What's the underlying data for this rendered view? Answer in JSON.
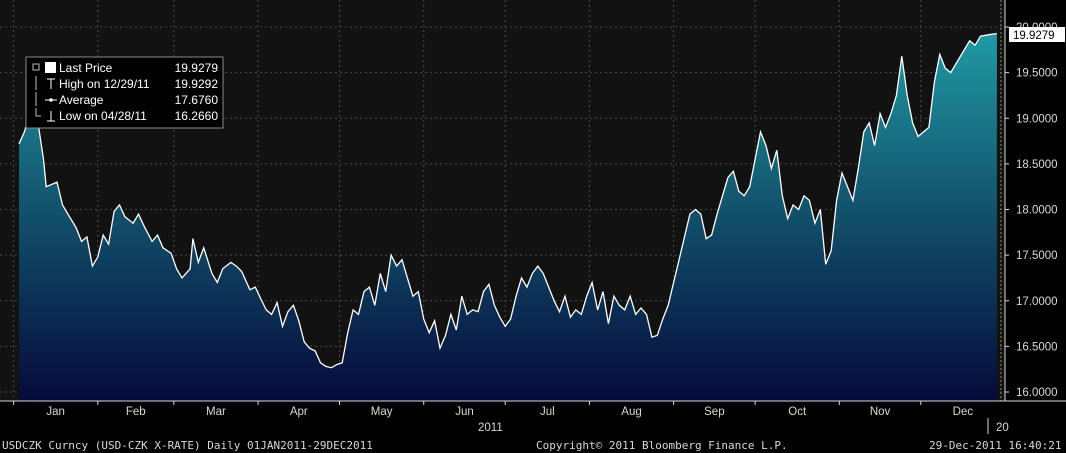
{
  "chart_data": {
    "type": "area",
    "title": "",
    "xlabel": "2011",
    "ylabel": "",
    "ylim": [
      15.95,
      20.05
    ],
    "yticks": [
      "16.0000",
      "16.5000",
      "17.0000",
      "17.5000",
      "18.0000",
      "18.5000",
      "19.0000",
      "19.5000",
      "20.0000"
    ],
    "month_labels": [
      "Jan",
      "Feb",
      "Mar",
      "Apr",
      "May",
      "Jun",
      "Jul",
      "Aug",
      "Sep",
      "Oct",
      "Nov",
      "Dec"
    ],
    "year_label": "2011",
    "next_year_label": "20",
    "last_price_label": "19.9279",
    "grid": true,
    "legend_placement": "top-left",
    "legend": [
      {
        "name": "Last Price",
        "value": "19.9279",
        "icon": "filled-square-icon"
      },
      {
        "name": "High on 12/29/11",
        "value": "19.9292",
        "icon": "high-marker-icon"
      },
      {
        "name": "Average",
        "value": "17.6760",
        "icon": "average-line-icon"
      },
      {
        "name": "Low on 04/28/11",
        "value": "16.2660",
        "icon": "low-marker-icon"
      }
    ],
    "series": [
      {
        "values": [
          {
            "x": "2011-01-03",
            "y": 18.72
          },
          {
            "x": "2011-01-05",
            "y": 18.85
          },
          {
            "x": "2011-01-07",
            "y": 19.05
          },
          {
            "x": "2011-01-10",
            "y": 18.95
          },
          {
            "x": "2011-01-12",
            "y": 18.55
          },
          {
            "x": "2011-01-13",
            "y": 18.25
          },
          {
            "x": "2011-01-17",
            "y": 18.3
          },
          {
            "x": "2011-01-19",
            "y": 18.05
          },
          {
            "x": "2011-01-21",
            "y": 17.95
          },
          {
            "x": "2011-01-24",
            "y": 17.8
          },
          {
            "x": "2011-01-26",
            "y": 17.65
          },
          {
            "x": "2011-01-28",
            "y": 17.7
          },
          {
            "x": "2011-01-30",
            "y": 17.38
          },
          {
            "x": "2011-02-01",
            "y": 17.48
          },
          {
            "x": "2011-02-03",
            "y": 17.72
          },
          {
            "x": "2011-02-05",
            "y": 17.62
          },
          {
            "x": "2011-02-07",
            "y": 17.98
          },
          {
            "x": "2011-02-09",
            "y": 18.05
          },
          {
            "x": "2011-02-11",
            "y": 17.92
          },
          {
            "x": "2011-02-14",
            "y": 17.85
          },
          {
            "x": "2011-02-16",
            "y": 17.95
          },
          {
            "x": "2011-02-18",
            "y": 17.82
          },
          {
            "x": "2011-02-21",
            "y": 17.65
          },
          {
            "x": "2011-02-23",
            "y": 17.72
          },
          {
            "x": "2011-02-25",
            "y": 17.58
          },
          {
            "x": "2011-02-28",
            "y": 17.52
          },
          {
            "x": "2011-03-02",
            "y": 17.35
          },
          {
            "x": "2011-03-04",
            "y": 17.25
          },
          {
            "x": "2011-03-07",
            "y": 17.35
          },
          {
            "x": "2011-03-08",
            "y": 17.68
          },
          {
            "x": "2011-03-10",
            "y": 17.42
          },
          {
            "x": "2011-03-12",
            "y": 17.58
          },
          {
            "x": "2011-03-15",
            "y": 17.3
          },
          {
            "x": "2011-03-17",
            "y": 17.2
          },
          {
            "x": "2011-03-19",
            "y": 17.35
          },
          {
            "x": "2011-03-22",
            "y": 17.42
          },
          {
            "x": "2011-03-24",
            "y": 17.38
          },
          {
            "x": "2011-03-26",
            "y": 17.32
          },
          {
            "x": "2011-03-29",
            "y": 17.12
          },
          {
            "x": "2011-03-31",
            "y": 17.15
          },
          {
            "x": "2011-04-02",
            "y": 17.02
          },
          {
            "x": "2011-04-04",
            "y": 16.9
          },
          {
            "x": "2011-04-06",
            "y": 16.85
          },
          {
            "x": "2011-04-08",
            "y": 16.98
          },
          {
            "x": "2011-04-10",
            "y": 16.72
          },
          {
            "x": "2011-04-12",
            "y": 16.88
          },
          {
            "x": "2011-04-14",
            "y": 16.95
          },
          {
            "x": "2011-04-16",
            "y": 16.78
          },
          {
            "x": "2011-04-18",
            "y": 16.55
          },
          {
            "x": "2011-04-20",
            "y": 16.48
          },
          {
            "x": "2011-04-22",
            "y": 16.45
          },
          {
            "x": "2011-04-24",
            "y": 16.32
          },
          {
            "x": "2011-04-26",
            "y": 16.28
          },
          {
            "x": "2011-04-28",
            "y": 16.266
          },
          {
            "x": "2011-04-30",
            "y": 16.3
          },
          {
            "x": "2011-05-02",
            "y": 16.32
          },
          {
            "x": "2011-05-04",
            "y": 16.65
          },
          {
            "x": "2011-05-06",
            "y": 16.9
          },
          {
            "x": "2011-05-08",
            "y": 16.85
          },
          {
            "x": "2011-05-10",
            "y": 17.1
          },
          {
            "x": "2011-05-12",
            "y": 17.15
          },
          {
            "x": "2011-05-14",
            "y": 16.95
          },
          {
            "x": "2011-05-16",
            "y": 17.3
          },
          {
            "x": "2011-05-18",
            "y": 17.1
          },
          {
            "x": "2011-05-20",
            "y": 17.5
          },
          {
            "x": "2011-05-22",
            "y": 17.38
          },
          {
            "x": "2011-05-24",
            "y": 17.45
          },
          {
            "x": "2011-05-26",
            "y": 17.25
          },
          {
            "x": "2011-05-28",
            "y": 17.05
          },
          {
            "x": "2011-05-30",
            "y": 17.1
          },
          {
            "x": "2011-06-01",
            "y": 16.8
          },
          {
            "x": "2011-06-03",
            "y": 16.65
          },
          {
            "x": "2011-06-05",
            "y": 16.78
          },
          {
            "x": "2011-06-07",
            "y": 16.48
          },
          {
            "x": "2011-06-09",
            "y": 16.62
          },
          {
            "x": "2011-06-11",
            "y": 16.85
          },
          {
            "x": "2011-06-13",
            "y": 16.68
          },
          {
            "x": "2011-06-15",
            "y": 17.05
          },
          {
            "x": "2011-06-17",
            "y": 16.85
          },
          {
            "x": "2011-06-19",
            "y": 16.9
          },
          {
            "x": "2011-06-21",
            "y": 16.88
          },
          {
            "x": "2011-06-23",
            "y": 17.1
          },
          {
            "x": "2011-06-25",
            "y": 17.18
          },
          {
            "x": "2011-06-27",
            "y": 16.95
          },
          {
            "x": "2011-06-29",
            "y": 16.82
          },
          {
            "x": "2011-07-01",
            "y": 16.72
          },
          {
            "x": "2011-07-03",
            "y": 16.8
          },
          {
            "x": "2011-07-05",
            "y": 17.05
          },
          {
            "x": "2011-07-07",
            "y": 17.25
          },
          {
            "x": "2011-07-09",
            "y": 17.15
          },
          {
            "x": "2011-07-11",
            "y": 17.3
          },
          {
            "x": "2011-07-13",
            "y": 17.38
          },
          {
            "x": "2011-07-15",
            "y": 17.3
          },
          {
            "x": "2011-07-17",
            "y": 17.15
          },
          {
            "x": "2011-07-19",
            "y": 17.0
          },
          {
            "x": "2011-07-21",
            "y": 16.88
          },
          {
            "x": "2011-07-23",
            "y": 17.05
          },
          {
            "x": "2011-07-25",
            "y": 16.82
          },
          {
            "x": "2011-07-27",
            "y": 16.9
          },
          {
            "x": "2011-07-29",
            "y": 16.85
          },
          {
            "x": "2011-07-31",
            "y": 17.05
          },
          {
            "x": "2011-08-02",
            "y": 17.2
          },
          {
            "x": "2011-08-04",
            "y": 16.9
          },
          {
            "x": "2011-08-06",
            "y": 17.1
          },
          {
            "x": "2011-08-08",
            "y": 16.75
          },
          {
            "x": "2011-08-10",
            "y": 17.05
          },
          {
            "x": "2011-08-12",
            "y": 16.95
          },
          {
            "x": "2011-08-14",
            "y": 16.9
          },
          {
            "x": "2011-08-16",
            "y": 17.05
          },
          {
            "x": "2011-08-18",
            "y": 16.85
          },
          {
            "x": "2011-08-20",
            "y": 16.92
          },
          {
            "x": "2011-08-22",
            "y": 16.85
          },
          {
            "x": "2011-08-24",
            "y": 16.6
          },
          {
            "x": "2011-08-26",
            "y": 16.62
          },
          {
            "x": "2011-08-28",
            "y": 16.8
          },
          {
            "x": "2011-08-30",
            "y": 16.95
          },
          {
            "x": "2011-09-01",
            "y": 17.2
          },
          {
            "x": "2011-09-03",
            "y": 17.45
          },
          {
            "x": "2011-09-05",
            "y": 17.7
          },
          {
            "x": "2011-09-07",
            "y": 17.95
          },
          {
            "x": "2011-09-09",
            "y": 18.0
          },
          {
            "x": "2011-09-11",
            "y": 17.95
          },
          {
            "x": "2011-09-13",
            "y": 17.68
          },
          {
            "x": "2011-09-15",
            "y": 17.72
          },
          {
            "x": "2011-09-17",
            "y": 17.95
          },
          {
            "x": "2011-09-19",
            "y": 18.15
          },
          {
            "x": "2011-09-21",
            "y": 18.35
          },
          {
            "x": "2011-09-23",
            "y": 18.42
          },
          {
            "x": "2011-09-25",
            "y": 18.2
          },
          {
            "x": "2011-09-27",
            "y": 18.15
          },
          {
            "x": "2011-09-29",
            "y": 18.25
          },
          {
            "x": "2011-10-01",
            "y": 18.55
          },
          {
            "x": "2011-10-03",
            "y": 18.85
          },
          {
            "x": "2011-10-05",
            "y": 18.7
          },
          {
            "x": "2011-10-07",
            "y": 18.45
          },
          {
            "x": "2011-10-09",
            "y": 18.65
          },
          {
            "x": "2011-10-11",
            "y": 18.15
          },
          {
            "x": "2011-10-13",
            "y": 17.9
          },
          {
            "x": "2011-10-15",
            "y": 18.05
          },
          {
            "x": "2011-10-17",
            "y": 18.0
          },
          {
            "x": "2011-10-19",
            "y": 18.15
          },
          {
            "x": "2011-10-21",
            "y": 18.1
          },
          {
            "x": "2011-10-23",
            "y": 17.85
          },
          {
            "x": "2011-10-25",
            "y": 18.0
          },
          {
            "x": "2011-10-27",
            "y": 17.4
          },
          {
            "x": "2011-10-29",
            "y": 17.55
          },
          {
            "x": "2011-10-31",
            "y": 18.1
          },
          {
            "x": "2011-11-02",
            "y": 18.4
          },
          {
            "x": "2011-11-04",
            "y": 18.25
          },
          {
            "x": "2011-11-06",
            "y": 18.1
          },
          {
            "x": "2011-11-08",
            "y": 18.45
          },
          {
            "x": "2011-11-10",
            "y": 18.85
          },
          {
            "x": "2011-11-12",
            "y": 18.95
          },
          {
            "x": "2011-11-14",
            "y": 18.7
          },
          {
            "x": "2011-11-16",
            "y": 19.05
          },
          {
            "x": "2011-11-18",
            "y": 18.9
          },
          {
            "x": "2011-11-20",
            "y": 19.05
          },
          {
            "x": "2011-11-22",
            "y": 19.25
          },
          {
            "x": "2011-11-24",
            "y": 19.68
          },
          {
            "x": "2011-11-26",
            "y": 19.25
          },
          {
            "x": "2011-11-28",
            "y": 18.95
          },
          {
            "x": "2011-11-30",
            "y": 18.8
          },
          {
            "x": "2011-12-02",
            "y": 18.85
          },
          {
            "x": "2011-12-04",
            "y": 18.9
          },
          {
            "x": "2011-12-06",
            "y": 19.4
          },
          {
            "x": "2011-12-08",
            "y": 19.7
          },
          {
            "x": "2011-12-10",
            "y": 19.55
          },
          {
            "x": "2011-12-12",
            "y": 19.5
          },
          {
            "x": "2011-12-14",
            "y": 19.6
          },
          {
            "x": "2011-12-16",
            "y": 19.7
          },
          {
            "x": "2011-12-19",
            "y": 19.85
          },
          {
            "x": "2011-12-21",
            "y": 19.8
          },
          {
            "x": "2011-12-23",
            "y": 19.9
          },
          {
            "x": "2011-12-27",
            "y": 19.92
          },
          {
            "x": "2011-12-29",
            "y": 19.9279
          }
        ]
      }
    ]
  },
  "footer": {
    "left": "USDCZK Curncy (USD-CZK X-RATE)  Daily 01JAN2011-29DEC2011",
    "center": "Copyright© 2011 Bloomberg Finance L.P.",
    "right": "29-Dec-2011 16:40:21"
  },
  "colors": {
    "background": "#000000",
    "plot_background": "#111111",
    "line": "#ffffff",
    "fill_top": "#1a8a96",
    "fill_bottom": "#050d40"
  }
}
